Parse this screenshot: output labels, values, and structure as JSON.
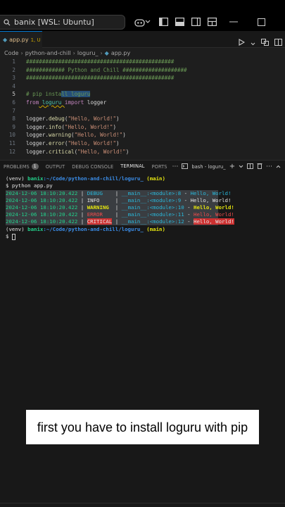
{
  "window": {
    "search_text": "banix [WSL: Ubuntu]"
  },
  "editor": {
    "tab": {
      "filename": "app.py",
      "meta": "1, U"
    },
    "breadcrumb": [
      "Code",
      "python-and-chill",
      "loguru_",
      "app.py"
    ],
    "lines": [
      {
        "n": "1",
        "text": "##############################################"
      },
      {
        "n": "2",
        "text": "############ Python and Chill ####################"
      },
      {
        "n": "3",
        "text": "##############################################"
      },
      {
        "n": "4",
        "text": ""
      },
      {
        "n": "5",
        "pre": "# pip insta",
        "selected": "ll loguru"
      },
      {
        "n": "6",
        "kw1": "from",
        "mod1": " loguru ",
        "kw2": "import",
        "rest": " logger"
      },
      {
        "n": "7",
        "text": ""
      },
      {
        "n": "8",
        "obj": "logger.",
        "fn": "debug",
        "open": "(",
        "str": "\"Hello, World!\"",
        "close": ")"
      },
      {
        "n": "9",
        "obj": "logger.",
        "fn": "info",
        "open": "(",
        "str": "\"Hello, World!\"",
        "close": ")"
      },
      {
        "n": "10",
        "obj": "logger.",
        "fn": "warning",
        "open": "(",
        "str": "\"Hello, World!\"",
        "close": ")"
      },
      {
        "n": "11",
        "obj": "logger.",
        "fn": "error",
        "open": "(",
        "str": "\"Hello, World!\"",
        "close": ")"
      },
      {
        "n": "12",
        "obj": "logger.",
        "fn": "critical",
        "open": "(",
        "str": "\"Hello, World!\"",
        "close": ")"
      }
    ]
  },
  "panel": {
    "tabs": [
      "PROBLEMS",
      "OUTPUT",
      "DEBUG CONSOLE",
      "TERMINAL",
      "PORTS"
    ],
    "problems_count": "1",
    "terminal_name": "bash - loguru_"
  },
  "terminal": {
    "prompt1_env": "(venv) ",
    "prompt1_user": "banix",
    "prompt1_path": ":~/Code/python-and-chill/loguru_",
    "prompt1_branch": " (main)",
    "command": "$ python app.py",
    "logs": [
      {
        "time": "2024-12-06 18:10:20.422",
        "level": "DEBUG   ",
        "loc": "__main__:<module>:8",
        "msg": "Hello, World!"
      },
      {
        "time": "2024-12-06 18:10:20.422",
        "level": "INFO    ",
        "loc": "__main__:<module>:9",
        "msg": "Hello, World!"
      },
      {
        "time": "2024-12-06 18:10:20.422",
        "level": "WARNING ",
        "loc": "__main__:<module>:10",
        "msg": "Hello, World!"
      },
      {
        "time": "2024-12-06 18:10:20.422",
        "level": "ERROR   ",
        "loc": "__main__:<module>:11",
        "msg": "Hello, World!"
      },
      {
        "time": "2024-12-06 18:10:20.422",
        "level": "CRITICAL",
        "loc": "__main__:<module>:12",
        "msg": "Hello, World!"
      }
    ],
    "prompt2_env": "(venv) ",
    "prompt2_user": "banix",
    "prompt2_path": ":~/Code/python-and-chill/loguru_",
    "prompt2_branch": " (main)",
    "cursor_line": "$ "
  },
  "caption": "first you have to install loguru with pip",
  "colors": {
    "accent": "#0078d4",
    "debug": "#29b8db",
    "warning": "#e5e510",
    "error": "#f14c4c",
    "prompt_green": "#23d18b"
  }
}
